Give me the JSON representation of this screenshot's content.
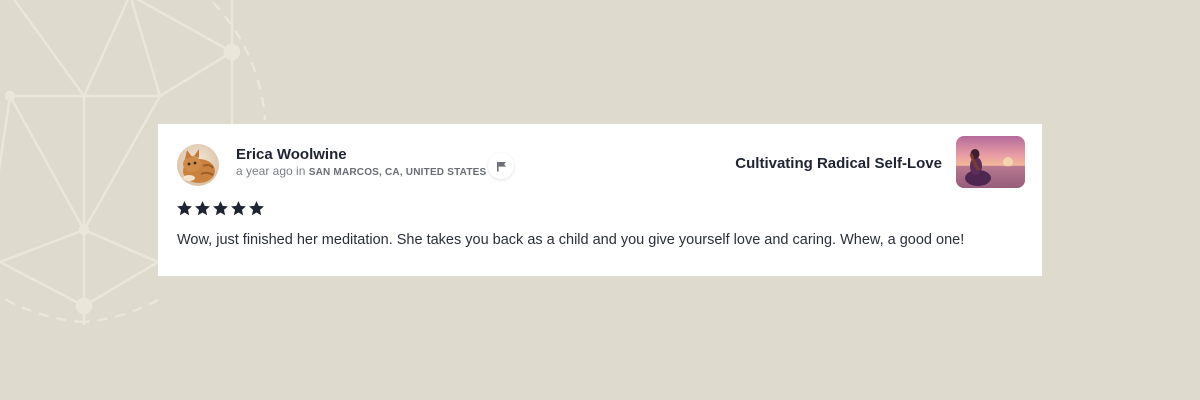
{
  "review": {
    "reviewer_name": "Erica Woolwine",
    "time_ago": "a year ago in ",
    "location": "SAN MARCOS, CA, UNITED STATES",
    "rating": 5,
    "text": "Wow, just finished her meditation. She takes you back as a child and you give yourself love and caring. Whew, a good one!",
    "course_title": "Cultivating Radical Self-Love"
  },
  "icons": {
    "flag": "flag-icon",
    "star": "star-icon"
  },
  "colors": {
    "background": "#dedace",
    "card": "#ffffff",
    "text_primary": "#1f2433",
    "text_secondary": "#7d7f88",
    "star": "#1f2433"
  }
}
